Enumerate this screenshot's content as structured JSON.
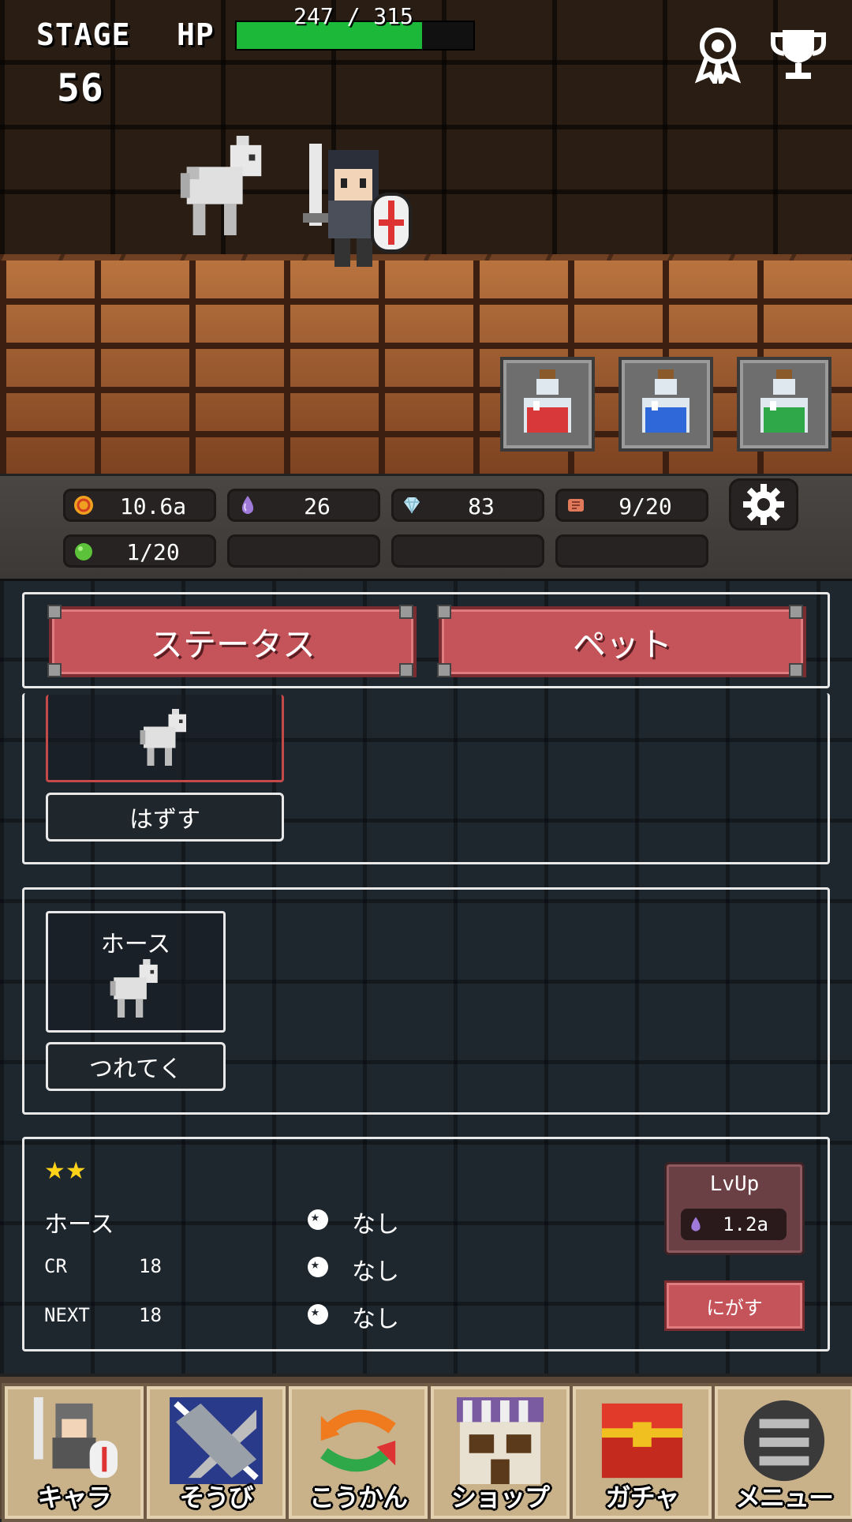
{
  "hud": {
    "stage_label": "STAGE",
    "stage_value": "56",
    "hp_label": "HP",
    "hp_current": 247,
    "hp_max": 315,
    "hp_text": "247 / 315",
    "hp_fraction": 0.784,
    "icons": [
      "ribbon-icon",
      "trophy-icon"
    ]
  },
  "potions": [
    {
      "name": "red-potion",
      "color": "#d9383a"
    },
    {
      "name": "blue-potion",
      "color": "#2f68d8"
    },
    {
      "name": "green-potion",
      "color": "#2fa84a"
    }
  ],
  "resources": {
    "gold": "10.6a",
    "soul": "26",
    "gem": "83",
    "scroll": "9/20",
    "egg": "1/20"
  },
  "tabs": {
    "status": "ステータス",
    "pet": "ペット"
  },
  "equipped": {
    "unequip_label": "はずす"
  },
  "pet_list": [
    {
      "name": "ホース",
      "action": "つれてく"
    }
  ],
  "detail": {
    "stars": "★★",
    "name": "ホース",
    "cr_label": "CR",
    "cr_value": "18",
    "next_label": "NEXT",
    "next_value": "18",
    "slots": [
      "なし",
      "なし",
      "なし"
    ],
    "lvup_label": "LvUp",
    "lvup_cost": "1.2a",
    "release_label": "にがす"
  },
  "nav": [
    {
      "label": "キャラ",
      "icon": "knight-icon"
    },
    {
      "label": "そうび",
      "icon": "equipment-icon"
    },
    {
      "label": "こうかん",
      "icon": "exchange-icon"
    },
    {
      "label": "ショップ",
      "icon": "shop-icon"
    },
    {
      "label": "ガチャ",
      "icon": "gacha-icon"
    },
    {
      "label": "メニュー",
      "icon": "menu-icon"
    }
  ],
  "colors": {
    "hp_green": "#1bb83a",
    "accent_red": "#c4545a",
    "panel_dark": "#1e262e"
  }
}
